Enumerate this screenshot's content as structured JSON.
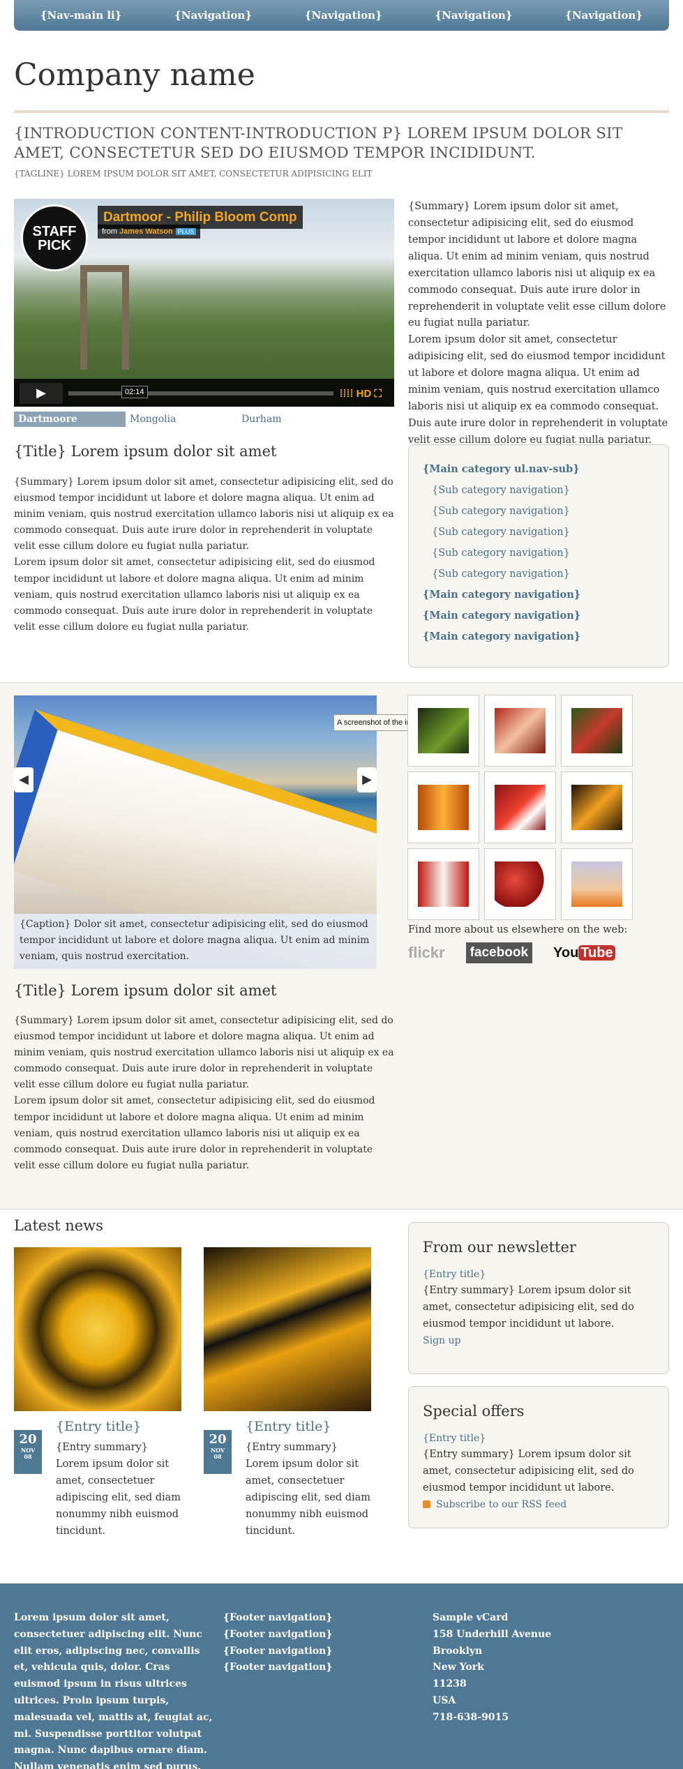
{
  "nav": [
    "{Nav-main li}",
    "{Navigation}",
    "{Navigation}",
    "{Navigation}",
    "{Navigation}"
  ],
  "brand": "Company name",
  "intro": "{INTRODUCTION CONTENT-INTRODUCTION P} LOREM IPSUM DOLOR SIT AMET, CONSECTETUR SED DO EIUSMOD TEMPOR INCIDIDUNT.",
  "tagline": "{TAGLINE} LOREM IPSUM DOLOR SIT AMET, CONSECTETUR ADIPISICING ELIT",
  "video": {
    "title": "Dartmoor - Philip Bloom Comp",
    "from_prefix": "from",
    "from_name": "James Watson",
    "plus": "PLUS",
    "badge_top": "STAFF",
    "badge_bottom": "PICK",
    "time": "02:14",
    "hd": "HD",
    "tabs": [
      "Dartmoore",
      "Mongolia",
      "Durham"
    ]
  },
  "summary_right": [
    "{Summary} Lorem ipsum dolor sit amet, consectetur adipisicing elit, sed do eiusmod tempor incididunt ut labore et dolore magna aliqua. Ut enim ad minim veniam, quis nostrud exercitation ullamco laboris nisi ut aliquip ex ea commodo consequat. Duis aute irure dolor in reprehenderit in voluptate velit esse cillum dolore eu fugiat nulla pariatur.",
    "Lorem ipsum dolor sit amet, consectetur adipisicing elit, sed do eiusmod tempor incididunt ut labore et dolore magna aliqua. Ut enim ad minim veniam, quis nostrud exercitation ullamco laboris nisi ut aliquip ex ea commodo consequat. Duis aute irure dolor in reprehenderit in voluptate velit esse cillum dolore eu fugiat nulla pariatur."
  ],
  "article1": {
    "title": "{Title} Lorem ipsum dolor sit amet",
    "p1": "{Summary} Lorem ipsum dolor sit amet, consectetur adipisicing elit, sed do eiusmod tempor incididunt ut labore et dolore magna aliqua. Ut enim ad minim veniam, quis nostrud exercitation ullamco laboris nisi ut aliquip ex ea commodo consequat. Duis aute irure dolor in reprehenderit in voluptate velit esse cillum dolore eu fugiat nulla pariatur.",
    "p2": "Lorem ipsum dolor sit amet, consectetur adipisicing elit, sed do eiusmod tempor incididunt ut labore et dolore magna aliqua. Ut enim ad minim veniam, quis nostrud exercitation ullamco laboris nisi ut aliquip ex ea commodo consequat. Duis aute irure dolor in reprehenderit in voluptate velit esse cillum dolore eu fugiat nulla pariatur."
  },
  "subnav": [
    {
      "label": "{Main category ul.nav-sub}",
      "type": "main"
    },
    {
      "label": "{Sub category navigation}",
      "type": "sub"
    },
    {
      "label": "{Sub category navigation}",
      "type": "sub"
    },
    {
      "label": "{Sub category navigation}",
      "type": "sub"
    },
    {
      "label": "{Sub category navigation}",
      "type": "sub"
    },
    {
      "label": "{Sub category navigation}",
      "type": "sub"
    },
    {
      "label": "{Main category navigation}",
      "type": "main"
    },
    {
      "label": "{Main category navigation}",
      "type": "main"
    },
    {
      "label": "{Main category navigation}",
      "type": "main"
    }
  ],
  "slideshow": {
    "caption": "{Caption} Dolor sit amet, consectetur adipisicing elit, sed do eiusmod tempor incididunt ut labore et dolore magna aliqua. Ut enim ad minim veniam, quis nostrud exercitation.",
    "tooltip": "A screenshot of the interface design"
  },
  "find_more": "Find more about us elsewhere on the web:",
  "social": {
    "flickr": "flickr",
    "facebook": "facebook",
    "youtube_you": "You",
    "youtube_tube": "Tube"
  },
  "article2": {
    "title": "{Title} Lorem ipsum dolor sit amet",
    "p1": "{Summary} Lorem ipsum dolor sit amet, consectetur adipisicing elit, sed do eiusmod tempor incididunt ut labore et dolore magna aliqua. Ut enim ad minim veniam, quis nostrud exercitation ullamco laboris nisi ut aliquip ex ea commodo consequat. Duis aute irure dolor in reprehenderit in voluptate velit esse cillum dolore eu fugiat nulla pariatur.",
    "p2": "Lorem ipsum dolor sit amet, consectetur adipisicing elit, sed do eiusmod tempor incididunt ut labore et dolore magna aliqua. Ut enim ad minim veniam, quis nostrud exercitation ullamco laboris nisi ut aliquip ex ea commodo consequat. Duis aute irure dolor in reprehenderit in voluptate velit esse cillum dolore eu fugiat nulla pariatur."
  },
  "news": {
    "heading": "Latest news",
    "items": [
      {
        "title": "{Entry title}",
        "day": "20",
        "month": "NOV",
        "year": "08",
        "summary": "{Entry summary} Lorem ipsum dolor sit amet, consectetuer adipiscing elit, sed diam nonummy nibh euismod tincidunt."
      },
      {
        "title": "{Entry title}",
        "day": "20",
        "month": "NOV",
        "year": "08",
        "summary": "{Entry summary} Lorem ipsum dolor sit amet, consectetuer adipiscing elit, sed diam nonummy nibh euismod tincidunt."
      }
    ]
  },
  "newsletter": {
    "heading": "From our newsletter",
    "entry_title": "{Entry title}",
    "summary": "{Entry summary} Lorem ipsum dolor sit amet, consectetur adipisicing elit, sed do eiusmod tempor incididunt ut labore.",
    "link": "Sign up"
  },
  "offers": {
    "heading": "Special offers",
    "entry_title": "{Entry title}",
    "summary": "{Entry summary} Lorem ipsum dolor sit amet, consectetur adipisicing elit, sed do eiusmod tempor incididunt ut labore.",
    "link": "Subscribe to our RSS feed"
  },
  "footer": {
    "text": "Lorem ipsum dolor sit amet, consectetuer adipiscing elit. Nunc elit eros, adipiscing nec, convallis et, vehicula quis, dolor. Cras euismod ipsum in risus ultrices ultrices. Proin ipsum turpis, malesuada vel, mattis at, feugiat ac, mi. Suspendisse porttitor volutpat magna. Nunc dapibus ornare diam. Nullam venenatis enim sed purus.",
    "nav": [
      "{Footer navigation}",
      "{Footer navigation}",
      "{Footer navigation}",
      "{Footer navigation}"
    ],
    "vcard": [
      "Sample vCard",
      "158 Underhill Avenue",
      "Brooklyn",
      "New York",
      "11238",
      "USA",
      "718-638-9015"
    ]
  }
}
